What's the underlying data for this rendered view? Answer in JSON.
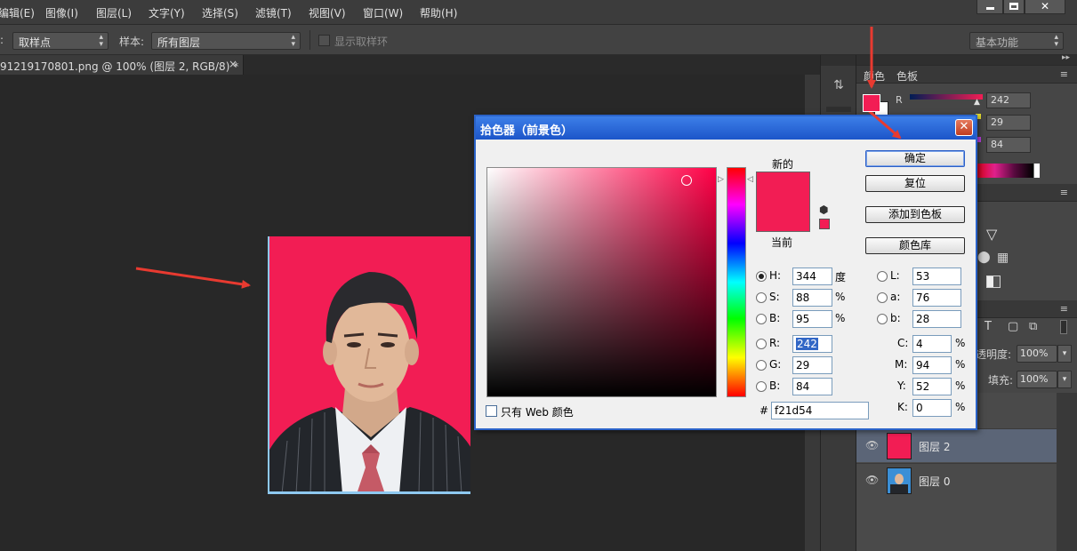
{
  "menu": [
    "编辑(E)",
    "图像(I)",
    "图层(L)",
    "文字(Y)",
    "选择(S)",
    "滤镜(T)",
    "视图(V)",
    "窗口(W)",
    "帮助(H)"
  ],
  "options": {
    "sample_tool_select": "取样点",
    "sample_label": "样本:",
    "sample_select": "所有图层",
    "show_ring_label": "显示取样环",
    "workspace_select": "基本功能"
  },
  "document": {
    "tab_title": "91219170801.png @ 100% (图层 2, RGB/8) *"
  },
  "color_panel": {
    "tab_color": "颜色",
    "tab_swatches": "色板",
    "r_label": "R",
    "r_value": "242",
    "g_value": "29",
    "b_value": "84",
    "foreground": "#f21d54"
  },
  "layers_panel": {
    "opacity_label": "透明度:",
    "opacity_value": "100%",
    "fill_label": "填充:",
    "fill_value": "100%",
    "layers": [
      {
        "name": "图层 2",
        "selected": true
      },
      {
        "name": "图层 0",
        "selected": false
      }
    ]
  },
  "picker": {
    "title": "拾色器（前景色）",
    "new_label": "新的",
    "current_label": "当前",
    "ok_button": "确定",
    "reset_button": "复位",
    "add_swatch_button": "添加到色板",
    "color_libraries_button": "颜色库",
    "web_only_label": "只有 Web 颜色",
    "hsb": {
      "h_label": "H:",
      "h": "344",
      "h_unit": "度",
      "s_label": "S:",
      "s": "88",
      "s_unit": "%",
      "b_label": "B:",
      "b": "95",
      "b_unit": "%"
    },
    "rgb": {
      "r_label": "R:",
      "r": "242",
      "g_label": "G:",
      "g": "29",
      "b_label": "B:",
      "b": "84"
    },
    "lab": {
      "l_label": "L:",
      "l": "53",
      "a_label": "a:",
      "a": "76",
      "b_label": "b:",
      "b": "28"
    },
    "cmyk": {
      "c_label": "C:",
      "c": "4",
      "m_label": "M:",
      "m": "94",
      "y_label": "Y:",
      "y": "52",
      "k_label": "K:",
      "k": "0",
      "unit": "%"
    },
    "hex_label": "#",
    "hex": "f21d54",
    "hue_color": "#ff0046",
    "selected_color": "#f21d54"
  }
}
